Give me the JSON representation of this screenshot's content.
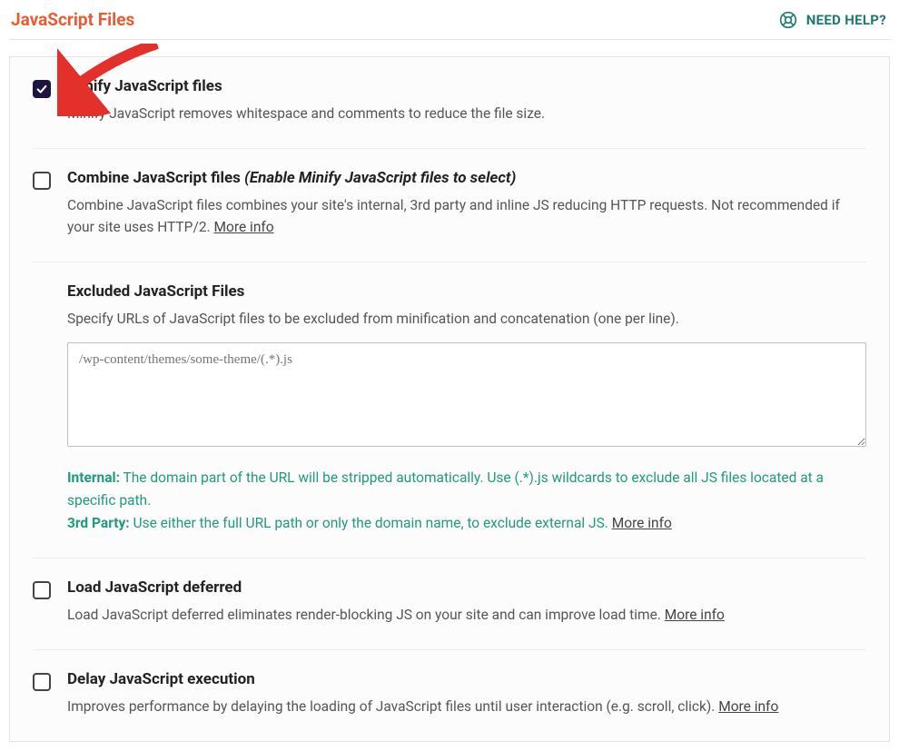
{
  "header": {
    "title": "JavaScript Files",
    "help_label": "NEED HELP?"
  },
  "options": {
    "minify": {
      "title": "Minify JavaScript files",
      "desc": "Minify JavaScript removes whitespace and comments to reduce the file size.",
      "checked": true
    },
    "combine": {
      "title": "Combine JavaScript files",
      "hint": "(Enable Minify JavaScript files to select)",
      "desc": "Combine JavaScript files combines your site's internal, 3rd party and inline JS reducing HTTP requests. Not recommended if your site uses HTTP/2. ",
      "more": "More info",
      "checked": false
    },
    "excluded": {
      "title": "Excluded JavaScript Files",
      "desc": "Specify URLs of JavaScript files to be excluded from minification and concatenation (one per line).",
      "placeholder": "/wp-content/themes/some-theme/(.*).js",
      "note_internal_label": "Internal:",
      "note_internal": " The domain part of the URL will be stripped automatically. Use (.*).js wildcards to exclude all JS files located at a specific path.",
      "note_3rd_label": "3rd Party:",
      "note_3rd": " Use either the full URL path or only the domain name, to exclude external JS. ",
      "more": "More info"
    },
    "deferred": {
      "title": "Load JavaScript deferred",
      "desc": "Load JavaScript deferred eliminates render-blocking JS on your site and can improve load time. ",
      "more": "More info",
      "checked": false
    },
    "delay": {
      "title": "Delay JavaScript execution",
      "desc": "Improves performance by delaying the loading of JavaScript files until user interaction (e.g. scroll, click). ",
      "more": "More info",
      "checked": false
    }
  }
}
